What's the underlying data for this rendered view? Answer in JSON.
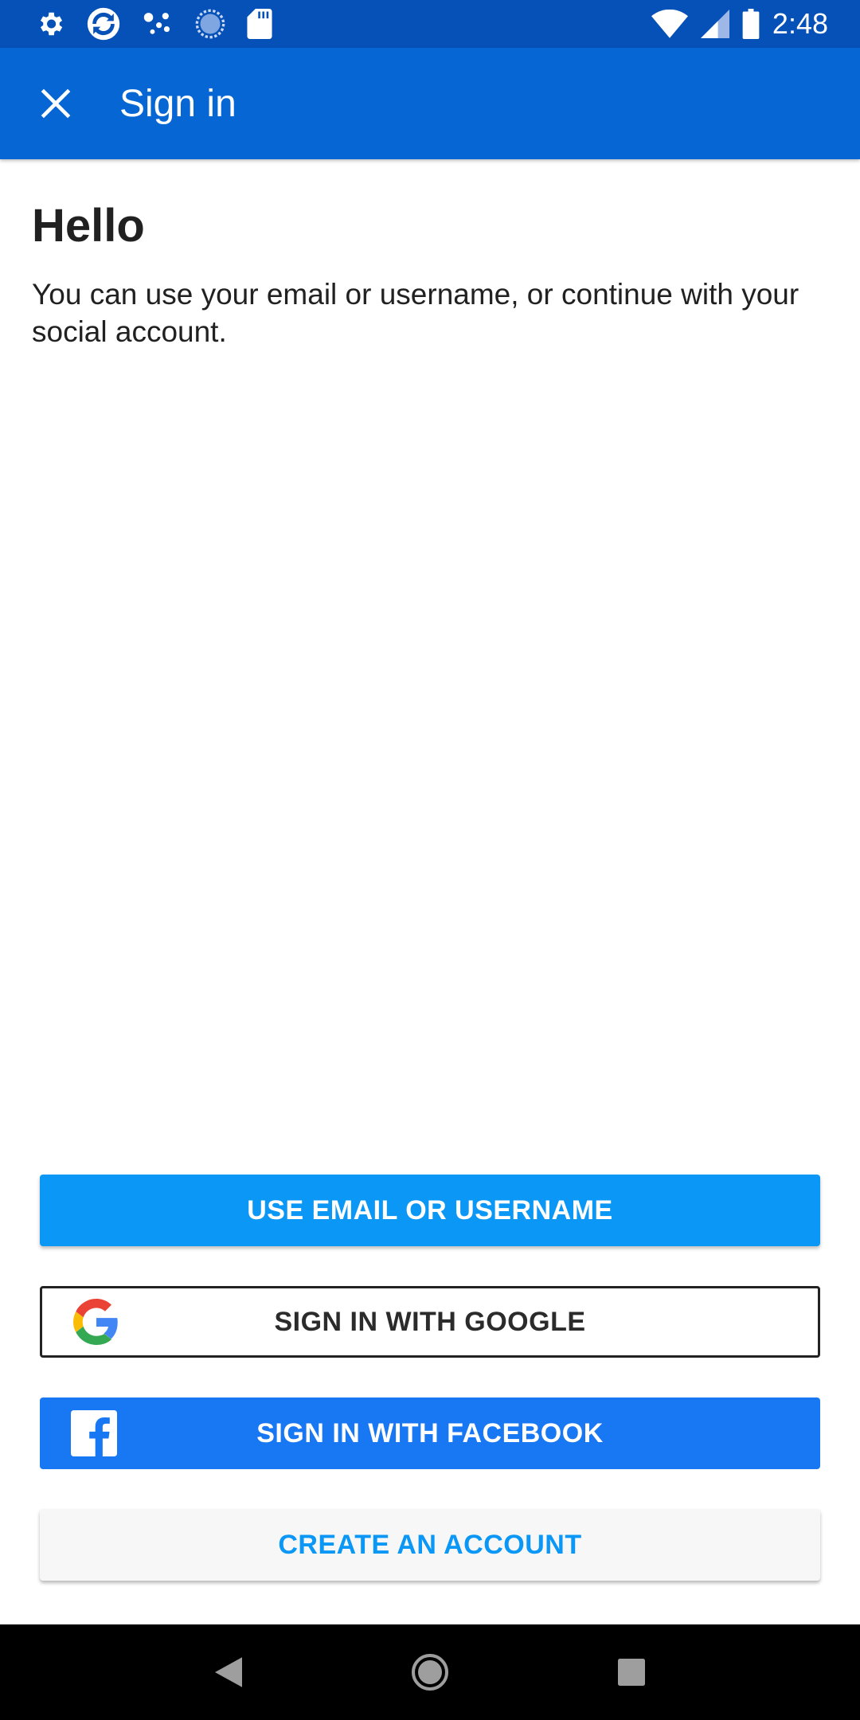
{
  "status_bar": {
    "time": "2:48",
    "icons": [
      "settings-icon",
      "sync-app-icon",
      "dots-icon",
      "loading-icon",
      "sd-card-icon",
      "wifi-icon",
      "signal-icon",
      "battery-icon"
    ]
  },
  "app_bar": {
    "title": "Sign in",
    "close_icon": "close-icon",
    "background": "#0666d4"
  },
  "main": {
    "heading": "Hello",
    "description": "You can use your email or username, or continue with your social account."
  },
  "buttons": {
    "email": "USE EMAIL OR USERNAME",
    "google": "SIGN IN WITH GOOGLE",
    "facebook": "SIGN IN WITH FACEBOOK",
    "create": "CREATE AN ACCOUNT"
  },
  "colors": {
    "status_bar": "#0551b8",
    "app_bar": "#0666d4",
    "email_button": "#0a97f5",
    "facebook_button": "#1877f2",
    "create_text": "#0a97f5"
  },
  "nav_bar": {
    "icons": [
      "back-icon",
      "home-icon",
      "recents-icon"
    ]
  }
}
